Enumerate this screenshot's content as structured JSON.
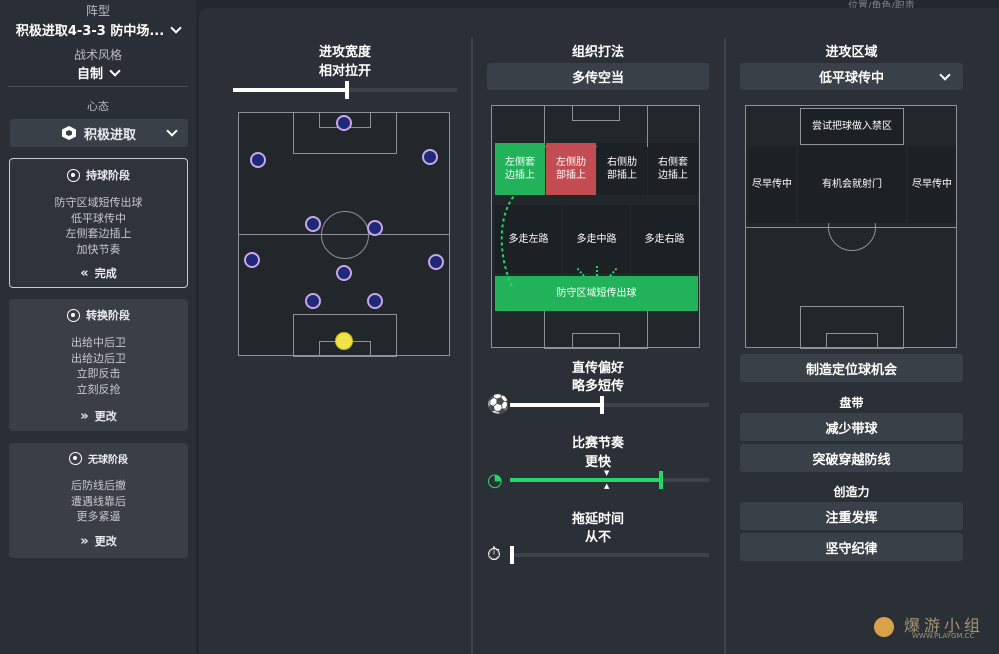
{
  "sidebar": {
    "formation_label": "阵型",
    "formation_value": "积极进取4-3-3 防中场...",
    "style_label": "战术风格",
    "style_value": "自制",
    "mentality_label": "心态",
    "mentality_value": "积极进取",
    "phases": [
      {
        "title": "持球阶段",
        "lines": [
          "防守区域短传出球",
          "低平球传中",
          "左侧套边插上",
          "加快节奏"
        ],
        "action": "完成"
      },
      {
        "title": "转换阶段",
        "lines": [
          "出给中后卫",
          "出给边后卫",
          "立即反击",
          "立刻反抢"
        ],
        "action": "更改"
      },
      {
        "title": "无球阶段",
        "lines": [
          "后防线后撤",
          "遭遇线靠后",
          "更多紧逼"
        ],
        "action": "更改"
      }
    ]
  },
  "top_right_text": "位置/角色/职责",
  "col1": {
    "title": "进攻宽度",
    "value": "相对拉开",
    "slider_fraction": 0.5
  },
  "col2": {
    "title": "组织打法",
    "dropdown": "多传空当",
    "zones": {
      "z1": "左侧套\n边插上",
      "z2": "左侧肋\n部插上",
      "z3": "右侧肋\n部插上",
      "z4": "右侧套\n边插上",
      "z5": "多走左路",
      "z6": "多走中路",
      "z7": "多走右路",
      "z8": "防守区域短传出球"
    },
    "passing_title": "直传偏好",
    "passing_value": "略多短传",
    "passing_fraction": 0.45,
    "tempo_title": "比赛节奏",
    "tempo_value": "更快",
    "tempo_fraction": 0.75,
    "timewaste_title": "拖延时间",
    "timewaste_value": "从不",
    "timewaste_fraction": 0.0
  },
  "col3": {
    "title": "进攻区域",
    "dropdown": "低平球传中",
    "zones": {
      "top": "尝试把球做入禁区",
      "left": "尽早传中",
      "mid": "有机会就射门",
      "right": "尽早传中"
    },
    "set_piece_button": "制造定位球机会",
    "dribbling_label": "盘带",
    "dribbling_button": "减少带球",
    "dribbling_button2": "突破穿越防线",
    "creativity_label": "创造力",
    "creativity_button": "注重发挥",
    "creativity_button2": "坚守纪律"
  },
  "watermark": {
    "text": "爆游小组",
    "url": "WWW.PLAYGM.CC"
  }
}
